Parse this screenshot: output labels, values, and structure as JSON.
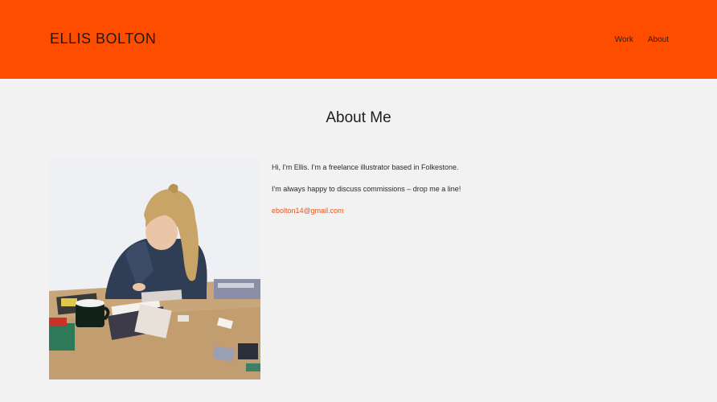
{
  "site": {
    "brand": "ELLIS BOLTON",
    "accent_color": "#ff4d00",
    "nav": [
      {
        "label": "Work"
      },
      {
        "label": "About"
      }
    ]
  },
  "page": {
    "title": "About Me"
  },
  "bio": {
    "line1": "Hi, I'm Ellis. I'm a freelance illustrator based in Folkestone.",
    "line2": "I'm always happy to discuss commissions – drop me a line!",
    "email": "ebolton14@gmail.com",
    "link_color": "#e8541c"
  },
  "photo": {
    "icon": "portrait-photo"
  }
}
